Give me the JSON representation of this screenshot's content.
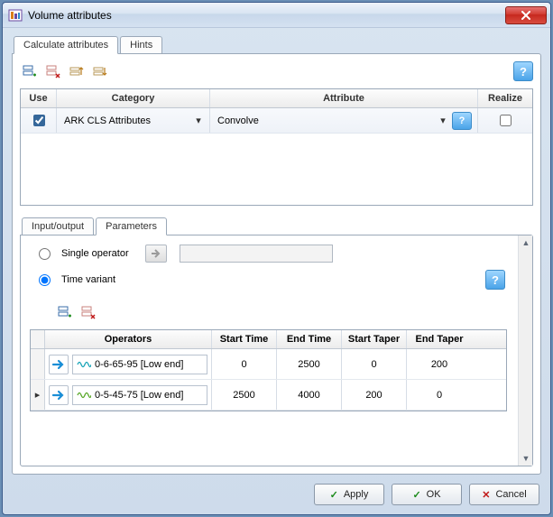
{
  "window": {
    "title": "Volume attributes"
  },
  "tabs": {
    "calc": "Calculate attributes",
    "hints": "Hints"
  },
  "grid1": {
    "headers": {
      "use": "Use",
      "category": "Category",
      "attribute": "Attribute",
      "realize": "Realize"
    },
    "row": {
      "use": true,
      "category": "ARK CLS Attributes",
      "attribute": "Convolve",
      "realize": false
    }
  },
  "inner_tabs": {
    "io": "Input/output",
    "params": "Parameters"
  },
  "params": {
    "radio_single": "Single operator",
    "radio_variant": "Time variant",
    "mode": "variant",
    "grid": {
      "headers": {
        "ops": "Operators",
        "start": "Start Time",
        "end": "End Time",
        "staper": "Start Taper",
        "etaper": "End Taper"
      },
      "rows": [
        {
          "name": "0-6-65-95 [Low end]",
          "start": "0",
          "end": "2500",
          "staper": "0",
          "etaper": "200",
          "color": "#1aa5b8",
          "current": false
        },
        {
          "name": "0-5-45-75 [Low end]",
          "start": "2500",
          "end": "4000",
          "staper": "200",
          "etaper": "0",
          "color": "#5aa82a",
          "current": true
        }
      ]
    }
  },
  "buttons": {
    "apply": "Apply",
    "ok": "OK",
    "cancel": "Cancel"
  },
  "help": "?"
}
